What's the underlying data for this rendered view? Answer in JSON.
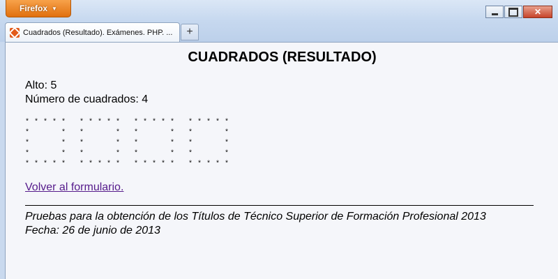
{
  "browser": {
    "menu_button_label": "Firefox",
    "menu_button_arrow": "▼",
    "tab_title": "Cuadrados (Resultado). Exámenes. PHP. ...",
    "new_tab_label": "+",
    "close_label": "✕"
  },
  "page": {
    "title": "CUADRADOS (RESULTADO)",
    "alto_line": "Alto: 5",
    "count_line": "Número de cuadrados: 4",
    "squares_art": "* * * * *   * * * * *   * * * * *   * * * * *\n*       *   *       *   *       *   *       *\n*       *   *       *   *       *   *       *\n*       *   *       *   *       *   *       *\n* * * * *   * * * * *   * * * * *   * * * * *",
    "back_link": "Volver al formulario.",
    "footer_line1": "Pruebas para la obtención de los Títulos de Técnico Superior de Formación Profesional 2013",
    "footer_line2": "Fecha: 26 de junio de 2013"
  },
  "colors": {
    "firefox_orange": "#e1700f",
    "link_visited": "#551a8b",
    "page_bg": "#f5f6fa"
  }
}
